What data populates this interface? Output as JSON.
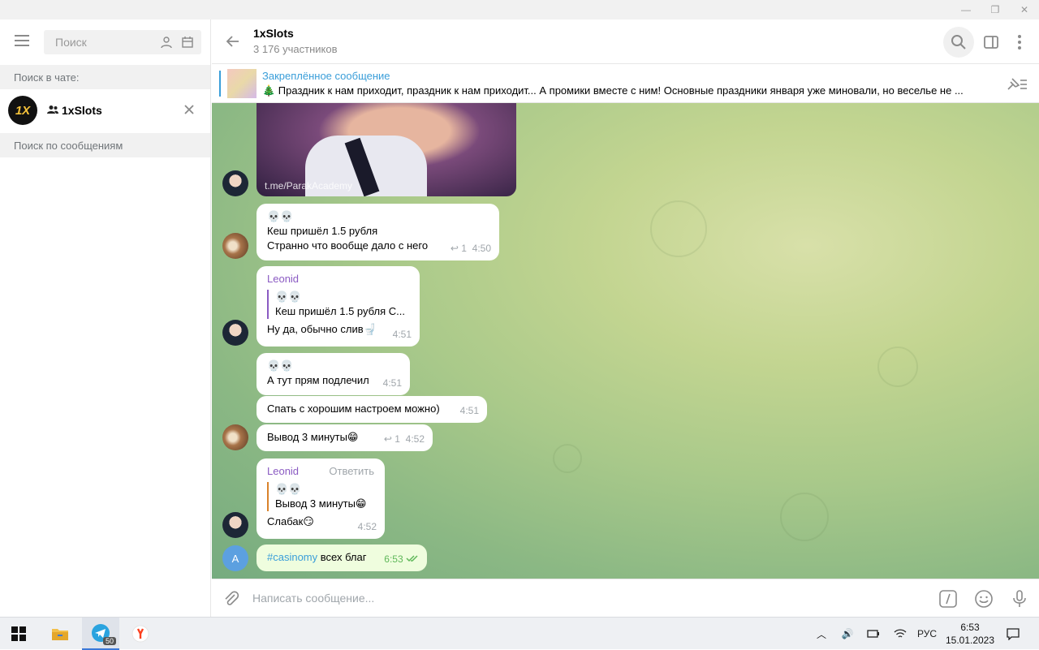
{
  "window": {
    "minimize": "—",
    "restore": "❐",
    "close": "✕"
  },
  "sidebar": {
    "search_placeholder": "Поиск",
    "search_in_chat_label": "Поиск в чате:",
    "found_chat": {
      "name": "1xSlots",
      "avatar_text": "1X"
    },
    "search_messages_label": "Поиск по сообщениям"
  },
  "header": {
    "title": "1xSlots",
    "subtitle": "3 176 участников"
  },
  "pinned": {
    "title": "Закреплённое сообщение",
    "text": "🎄 Праздник к нам приходит, праздник к нам приходит... А промики вместе с ним! Основные праздники января уже миновали, но веселье не ..."
  },
  "messages": {
    "m1": {
      "link": "t.me/ParakAcademy"
    },
    "m2": {
      "emoji": "💀💀",
      "line1": "Кеш пришёл 1.5 рубля",
      "line2": "Странно что вообще дало с него",
      "replies": "1",
      "time": "4:50"
    },
    "m3": {
      "author": "Leonid",
      "quote_emoji": "💀💀",
      "quote_text": "Кеш пришёл 1.5 рубля С...",
      "text": "Ну да, обычно слив🚽",
      "time": "4:51"
    },
    "m4": {
      "emoji": "💀💀",
      "text": "А тут прям подлечил",
      "time": "4:51"
    },
    "m5": {
      "text": "Спать с хорошим настроем можно)",
      "time": "4:51"
    },
    "m6": {
      "text": "Вывод 3 минуты😁",
      "replies": "1",
      "time": "4:52"
    },
    "m7": {
      "author": "Leonid",
      "reply_action": "Ответить",
      "quote_emoji": "💀💀",
      "quote_text": "Вывод 3 минуты😁",
      "text": "Слабак😏",
      "time": "4:52"
    },
    "m8": {
      "avatar": "A",
      "hashtag": "#casinomy",
      "text": " всех благ",
      "time": "6:53"
    }
  },
  "composer": {
    "placeholder": "Написать сообщение..."
  },
  "taskbar": {
    "telegram_badge": "50",
    "lang": "РУС",
    "time": "6:53",
    "date": "15.01.2023"
  },
  "colors": {
    "accent": "#3a9ed9",
    "author": "#8b5bc3",
    "own_bubble": "#effdde"
  }
}
